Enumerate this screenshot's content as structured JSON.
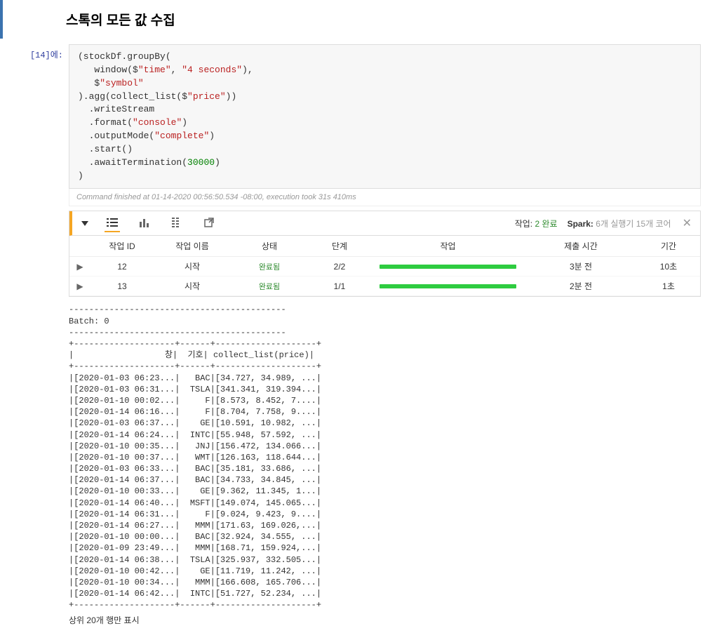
{
  "heading": "스톡의 모든 값 수집",
  "prompt": "[14]에:",
  "code_lines": [
    {
      "plain": "(stockDf.groupBy("
    },
    {
      "indent": "   ",
      "pre": "window($",
      "str1": "\"time\"",
      "mid": ", ",
      "str2": "\"4 seconds\"",
      "post": "),"
    },
    {
      "indent": "   ",
      "pre": "$",
      "str1": "\"symbol\"",
      "post": ""
    },
    {
      "plain": ").agg(collect_list($",
      "str1": "\"price\"",
      "post": "))"
    },
    {
      "indent": "  ",
      "plain": ".writeStream"
    },
    {
      "indent": "  ",
      "pre": ".format(",
      "str1": "\"console\"",
      "post": ")"
    },
    {
      "indent": "  ",
      "pre": ".outputMode(",
      "str1": "\"complete\"",
      "post": ")"
    },
    {
      "indent": "  ",
      "plain": ".start()"
    },
    {
      "indent": "  ",
      "pre": ".awaitTermination(",
      "num": "30000",
      "post": ")"
    },
    {
      "plain": ")"
    }
  ],
  "status_line": "Command finished at 01-14-2020 00:56:50.534 -08:00, execution took 31s 410ms",
  "job_header": {
    "jobs_label": "작업:",
    "jobs_value": "2 완료",
    "spark_label": "Spark:",
    "spark_value": "6개 실행기 15개 코어"
  },
  "job_table": {
    "headers": {
      "job_id": "작업 ID",
      "job_name": "작업 이름",
      "status": "상태",
      "stage": "단계",
      "job": "작업",
      "submit": "제출 시간",
      "duration": "기간"
    },
    "rows": [
      {
        "id": "12",
        "name": "시작",
        "status": "완료됨",
        "stage": "2/2",
        "submit": "3분 전",
        "duration": "10초"
      },
      {
        "id": "13",
        "name": "시작",
        "status": "완료됨",
        "stage": "1/1",
        "submit": "2분 전",
        "duration": "1초"
      }
    ]
  },
  "output_lines": [
    "-------------------------------------------",
    "Batch: 0",
    "-------------------------------------------",
    "+--------------------+------+--------------------+",
    "|                  창|  기호| collect_list(price)|",
    "+--------------------+------+--------------------+",
    "|[2020-01-03 06:23...|   BAC|[34.727, 34.989, ...|",
    "|[2020-01-03 06:31...|  TSLA|[341.341, 319.394...|",
    "|[2020-01-10 00:02...|     F|[8.573, 8.452, 7....|",
    "|[2020-01-14 06:16...|     F|[8.704, 7.758, 9....|",
    "|[2020-01-03 06:37...|    GE|[10.591, 10.982, ...|",
    "|[2020-01-14 06:24...|  INTC|[55.948, 57.592, ...|",
    "|[2020-01-10 00:35...|   JNJ|[156.472, 134.066...|",
    "|[2020-01-10 00:37...|   WMT|[126.163, 118.644...|",
    "|[2020-01-03 06:33...|   BAC|[35.181, 33.686, ...|",
    "|[2020-01-14 06:37...|   BAC|[34.733, 34.845, ...|",
    "|[2020-01-10 00:33...|    GE|[9.362, 11.345, 1...|",
    "|[2020-01-14 06:40...|  MSFT|[149.074, 145.065...|",
    "|[2020-01-14 06:31...|     F|[9.024, 9.423, 9....|",
    "|[2020-01-14 06:27...|   MMM|[171.63, 169.026,...|",
    "|[2020-01-10 00:00...|   BAC|[32.924, 34.555, ...|",
    "|[2020-01-09 23:49...|   MMM|[168.71, 159.924,...|",
    "|[2020-01-14 06:38...|  TSLA|[325.937, 332.505...|",
    "|[2020-01-10 00:42...|    GE|[11.719, 11.242, ...|",
    "|[2020-01-10 00:34...|   MMM|[166.608, 165.706...|",
    "|[2020-01-14 06:42...|  INTC|[51.727, 52.234, ...|",
    "+--------------------+------+--------------------+"
  ],
  "footer_note": "상위 20개 행만 표시"
}
